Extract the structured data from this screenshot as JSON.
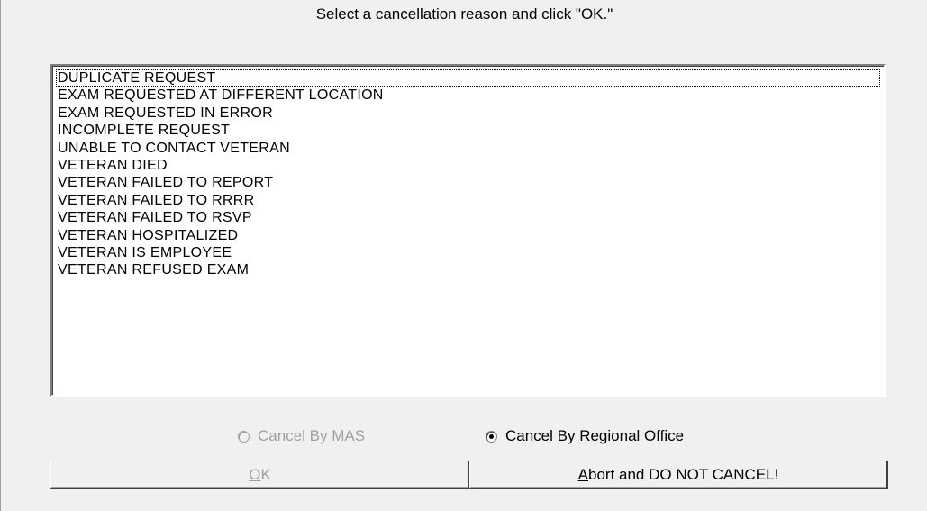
{
  "instruction": "Select a cancellation reason and click \"OK.\"",
  "reasons": [
    "DUPLICATE REQUEST",
    "EXAM REQUESTED AT DIFFERENT LOCATION",
    "EXAM REQUESTED IN ERROR",
    "INCOMPLETE REQUEST",
    "UNABLE TO CONTACT VETERAN",
    "VETERAN DIED",
    "VETERAN FAILED TO REPORT",
    "VETERAN FAILED TO RRRR",
    "VETERAN FAILED TO RSVP",
    "VETERAN HOSPITALIZED",
    "VETERAN IS EMPLOYEE",
    "VETERAN REFUSED EXAM"
  ],
  "focused_index": 0,
  "options": {
    "cancel_by_mas": {
      "label": "Cancel By MAS",
      "selected": false,
      "enabled": false
    },
    "cancel_by_regional_office": {
      "label": "Cancel By Regional Office",
      "selected": true,
      "enabled": true
    }
  },
  "buttons": {
    "ok": {
      "mnemonic": "O",
      "rest": "K",
      "enabled": false
    },
    "abort": {
      "mnemonic": "A",
      "rest": "bort and DO NOT CANCEL!",
      "enabled": true
    }
  }
}
